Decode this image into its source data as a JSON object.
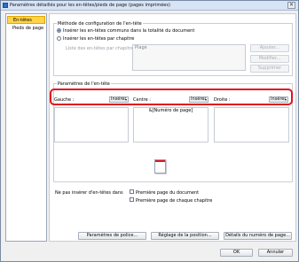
{
  "window": {
    "title": "Paramètres détaillés pour les en-têtes/pieds de page (pages imprimées)",
    "close_symbol": "✕"
  },
  "nav": {
    "items": [
      {
        "label": "En-têtes",
        "selected": true
      },
      {
        "label": "Pieds de page",
        "selected": false
      }
    ]
  },
  "config": {
    "legend": "Méthode de configuration de l'en-tête",
    "radio_all": "Insérer les en-têtes communs dans la totalité du document",
    "radio_per_chapter": "Insérer les en-têtes par chapitre",
    "list_label": "Liste des en-têtes par chapitre :",
    "list_column": "Plage",
    "btn_add": "Ajouter...",
    "btn_modify": "Modifier...",
    "btn_delete": "Supprimer"
  },
  "header_params": {
    "legend": "Paramètres de l'en-tête",
    "left_label": "Gauche :",
    "center_label": "Centre :",
    "right_label": "Droite :",
    "insert_label": "Insérer",
    "center_content": "&[Numéro de page]"
  },
  "no_header": {
    "label": "Ne pas insérer d'en-têtes dans",
    "first_page_doc": "Première page du document",
    "first_page_chapter": "Première page de chaque chapitre"
  },
  "buttons": {
    "font": "Paramètres de police...",
    "position": "Réglage de la position...",
    "page_number": "Détails du numéro de page...",
    "ok": "OK",
    "cancel": "Annuler"
  },
  "colors": {
    "highlight": "#e0141e",
    "selected_nav": "#ffd34a"
  }
}
